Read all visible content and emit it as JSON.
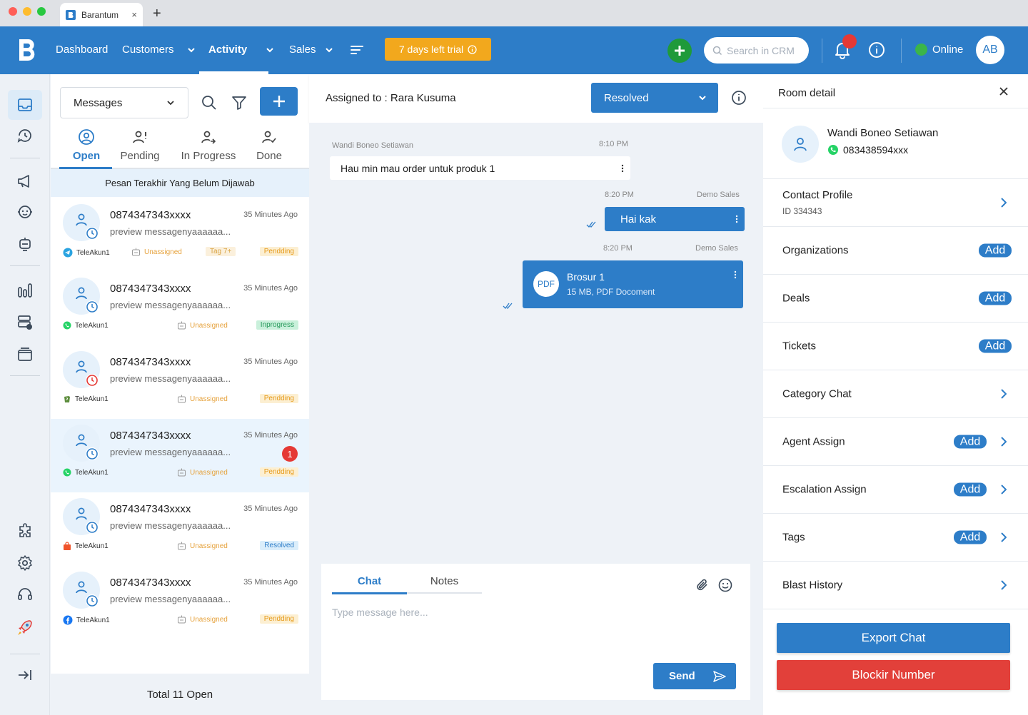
{
  "browser": {
    "tab_title": "Barantum",
    "close_glyph": "×",
    "new_tab_glyph": "+"
  },
  "nav": {
    "items": [
      "Dashboard",
      "Customers",
      "Activity",
      "Sales"
    ],
    "active": "Activity",
    "trial_label": "7 days left trial",
    "search_placeholder": "Search in CRM",
    "status_label": "Online",
    "avatar_initials": "AB"
  },
  "list": {
    "selector_label": "Messages",
    "tabs": [
      "Open",
      "Pending",
      "In Progress",
      "Done"
    ],
    "active_tab": "Open",
    "banner": "Pesan Terakhir Yang Belum Dijawab",
    "total_label": "Total 11 Open",
    "conversations": [
      {
        "number": "0874347343xxxx",
        "time": "35 Minutes Ago",
        "preview": "preview messagenyaaaaaa...",
        "channel": "TeleAkun1",
        "channel_icon": "telegram-icon",
        "assignee": "Unassigned",
        "tag": "Tag 7+",
        "status": "Pendding",
        "clock": "blue-clock-icon",
        "unread": ""
      },
      {
        "number": "0874347343xxxx",
        "time": "35 Minutes Ago",
        "preview": "preview messagenyaaaaaa...",
        "channel": "TeleAkun1",
        "channel_icon": "whatsapp-icon",
        "assignee": "Unassigned",
        "tag": "",
        "status": "Inprogress",
        "clock": "blue-clock-icon",
        "unread": ""
      },
      {
        "number": "0874347343xxxx",
        "time": "35 Minutes Ago",
        "preview": "preview messagenyaaaaaa...",
        "channel": "TeleAkun1",
        "channel_icon": "shopify-icon",
        "assignee": "Unassigned",
        "tag": "",
        "status": "Pendding",
        "clock": "red-clock-icon",
        "unread": ""
      },
      {
        "number": "0874347343xxxx",
        "time": "35 Minutes Ago",
        "preview": "preview messagenyaaaaaa...",
        "channel": "TeleAkun1",
        "channel_icon": "whatsapp-icon",
        "assignee": "Unassigned",
        "tag": "",
        "status": "Pendding",
        "clock": "blue-clock-icon",
        "unread": "1"
      },
      {
        "number": "0874347343xxxx",
        "time": "35 Minutes Ago",
        "preview": "preview messagenyaaaaaa...",
        "channel": "TeleAkun1",
        "channel_icon": "shop-bag-icon",
        "assignee": "Unassigned",
        "tag": "",
        "status": "Resolved",
        "clock": "blue-clock-icon",
        "unread": ""
      },
      {
        "number": "0874347343xxxx",
        "time": "35 Minutes Ago",
        "preview": "preview messagenyaaaaaa...",
        "channel": "TeleAkun1",
        "channel_icon": "facebook-icon",
        "assignee": "Unassigned",
        "tag": "",
        "status": "Pendding",
        "clock": "blue-clock-icon",
        "unread": ""
      }
    ]
  },
  "chat": {
    "assigned_label": "Assigned to : Rara Kusuma",
    "status_value": "Resolved",
    "messages": [
      {
        "sender": "Wandi Boneo Setiawan",
        "time": "8:10 PM",
        "text": "Hau min mau order untuk produk 1"
      },
      {
        "sender": "Demo Sales",
        "time": "8:20 PM",
        "text": "Hai kak"
      },
      {
        "sender": "Demo Sales",
        "time": "8:20 PM",
        "file_badge": "PDF",
        "file_name": "Brosur 1",
        "file_meta": "15 MB, PDF Docoment"
      }
    ],
    "composer": {
      "tabs": [
        "Chat",
        "Notes"
      ],
      "active_tab": "Chat",
      "placeholder": "Type message here...",
      "send_label": "Send"
    }
  },
  "room": {
    "title": "Room detail",
    "contact_name": "Wandi Boneo Setiawan",
    "contact_phone": "083438594xxx",
    "profile_label": "Contact Profile",
    "profile_id": "ID 334343",
    "rows": [
      {
        "label": "Organizations",
        "add": "Add",
        "chevron": false
      },
      {
        "label": "Deals",
        "add": "Add",
        "chevron": false
      },
      {
        "label": "Tickets",
        "add": "Add",
        "chevron": false
      },
      {
        "label": "Category Chat",
        "add": "",
        "chevron": true
      },
      {
        "label": "Agent Assign",
        "add": "Add",
        "chevron": true
      },
      {
        "label": "Escalation Assign",
        "add": "Add",
        "chevron": true
      },
      {
        "label": "Tags",
        "add": "Add",
        "chevron": true
      },
      {
        "label": "Blast History",
        "add": "",
        "chevron": true
      }
    ],
    "export_label": "Export Chat",
    "block_label": "Blockir Number"
  },
  "colors": {
    "primary": "#2d7dc8",
    "trial": "#f2a81d",
    "danger": "#e2403a",
    "online": "#3bb54a"
  }
}
